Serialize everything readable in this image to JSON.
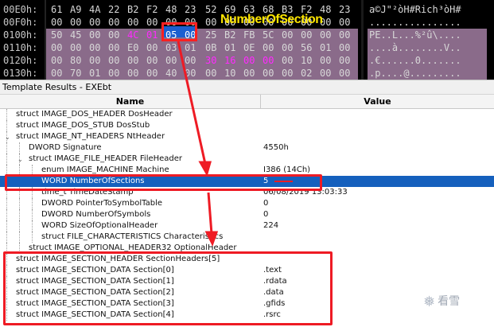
{
  "hex": {
    "rows": [
      {
        "addr": "00E0h:",
        "bytes": [
          "61",
          "A9",
          "4A",
          "22",
          "B2",
          "F2",
          "48",
          "23",
          "52",
          "69",
          "63",
          "68",
          "B3",
          "F2",
          "48",
          "23"
        ],
        "ascii": "a©J\"²òH#Rich³òH#"
      },
      {
        "addr": "00F0h:",
        "bytes": [
          "00",
          "00",
          "00",
          "00",
          "00",
          "00",
          "00",
          "00",
          "00",
          "00",
          "00",
          "00",
          "00",
          "00",
          "00",
          "00"
        ],
        "ascii": "................"
      },
      {
        "addr": "0100h:",
        "bytes": [
          "50",
          "45",
          "00",
          "00",
          "4C",
          "01",
          "05",
          "00",
          "25",
          "B2",
          "FB",
          "5C",
          "00",
          "00",
          "00",
          "00"
        ],
        "ascii": "PE..L...%²û\\...."
      },
      {
        "addr": "0110h:",
        "bytes": [
          "00",
          "00",
          "00",
          "00",
          "E0",
          "00",
          "03",
          "01",
          "0B",
          "01",
          "0E",
          "00",
          "00",
          "56",
          "01",
          "00"
        ],
        "ascii": "....à........V.."
      },
      {
        "addr": "0120h:",
        "bytes": [
          "00",
          "80",
          "00",
          "00",
          "00",
          "00",
          "00",
          "00",
          "30",
          "16",
          "00",
          "00",
          "00",
          "10",
          "00",
          "00"
        ],
        "ascii": ".€......0......."
      },
      {
        "addr": "0130h:",
        "bytes": [
          "00",
          "70",
          "01",
          "00",
          "00",
          "00",
          "40",
          "00",
          "00",
          "10",
          "00",
          "00",
          "00",
          "02",
          "00",
          "00"
        ],
        "ascii": ".p....@........."
      }
    ],
    "callout": "NumberOfSection"
  },
  "panel": {
    "title": "Template Results - EXEbt",
    "col_name": "Name",
    "col_value": "Value"
  },
  "rows": [
    {
      "name": "struct IMAGE_DOS_HEADER DosHeader",
      "value": "",
      "level": 0,
      "expander": ""
    },
    {
      "name": "struct IMAGE_DOS_STUB DosStub",
      "value": "",
      "level": 0,
      "expander": ""
    },
    {
      "name": "struct IMAGE_NT_HEADERS NtHeader",
      "value": "",
      "level": 0,
      "expander": "⌄"
    },
    {
      "name": "DWORD Signature",
      "value": "4550h",
      "level": 1,
      "expander": ""
    },
    {
      "name": "struct IMAGE_FILE_HEADER FileHeader",
      "value": "",
      "level": 1,
      "expander": "⌄"
    },
    {
      "name": "enum IMAGE_MACHINE Machine",
      "value": "I386 (14Ch)",
      "level": 2,
      "expander": ""
    },
    {
      "name": "WORD NumberOfSections",
      "value": "5",
      "level": 2,
      "expander": "",
      "selected": true
    },
    {
      "name": "time_t TimeDateStamp",
      "value": "06/08/2019 13:03:33",
      "level": 2,
      "expander": ""
    },
    {
      "name": "DWORD PointerToSymbolTable",
      "value": "0",
      "level": 2,
      "expander": ""
    },
    {
      "name": "DWORD NumberOfSymbols",
      "value": "0",
      "level": 2,
      "expander": ""
    },
    {
      "name": "WORD SizeOfOptionalHeader",
      "value": "224",
      "level": 2,
      "expander": ""
    },
    {
      "name": "struct FILE_CHARACTERISTICS Characteristics",
      "value": "",
      "level": 2,
      "expander": ""
    },
    {
      "name": "struct IMAGE_OPTIONAL_HEADER32 OptionalHeader",
      "value": "",
      "level": 1,
      "expander": ""
    },
    {
      "name": "struct IMAGE_SECTION_HEADER SectionHeaders[5]",
      "value": "",
      "level": 0,
      "expander": ""
    },
    {
      "name": "struct IMAGE_SECTION_DATA Section[0]",
      "value": ".text",
      "level": 0,
      "expander": ""
    },
    {
      "name": "struct IMAGE_SECTION_DATA Section[1]",
      "value": ".rdata",
      "level": 0,
      "expander": ""
    },
    {
      "name": "struct IMAGE_SECTION_DATA Section[2]",
      "value": ".data",
      "level": 0,
      "expander": ""
    },
    {
      "name": "struct IMAGE_SECTION_DATA Section[3]",
      "value": ".gfids",
      "level": 0,
      "expander": ""
    },
    {
      "name": "struct IMAGE_SECTION_DATA Section[4]",
      "value": ".rsrc",
      "level": 0,
      "expander": ""
    }
  ],
  "watermark": {
    "text": "看雪",
    "icon": "snowflake-icon"
  },
  "colors": {
    "highlight": "#1560bd",
    "annotation": "#ee1b24",
    "callout": "#ffe600"
  }
}
